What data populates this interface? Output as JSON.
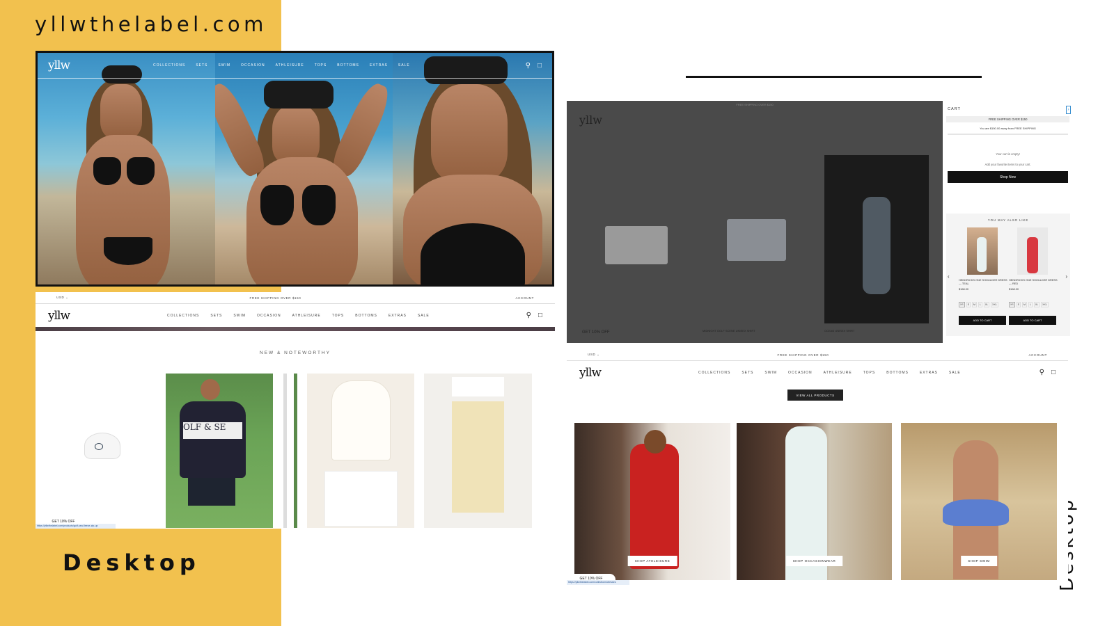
{
  "page": {
    "site_title": "yllwthelabel.com",
    "left_label": "Desktop",
    "right_label": "Desktop"
  },
  "colors": {
    "accent_yellow": "#F2C14E",
    "text": "#111111"
  },
  "brand": {
    "logo": "yllw"
  },
  "nav": {
    "items": [
      "COLLECTIONS",
      "SETS",
      "SWIM",
      "OCCASION",
      "ATHLEISURE",
      "TOPS",
      "BOTTOMS",
      "EXTRAS",
      "SALE"
    ],
    "icons": [
      "search-icon",
      "bag-icon"
    ]
  },
  "topbar": {
    "currency": "USD ⌄",
    "shipping": "FREE SHIPPING OVER $150",
    "account": "ACCOUNT"
  },
  "home": {
    "section_title": "NEW & NOTEWORTHY",
    "popup": "GET 10% OFF",
    "url": "https://yllwthelabel.com/products/golf-sea-fleece-zip-up"
  },
  "cart": {
    "title": "CART",
    "free_shipping": "FREE SHIPPING OVER $150",
    "away_text": "You are $150.00 away from FREE SHIPPING",
    "empty": "Your cart is empty!",
    "add_favorites": "Add your favorite items to your cart.",
    "shop_now": "Shop Now",
    "you_may_also_like": "YOU MAY ALSO LIKE",
    "products": [
      {
        "name": "HENDRICKS ONE SHOULDER DRESS — TEAL",
        "price": "$168.00",
        "button": "ADD TO CART"
      },
      {
        "name": "HENDRICKS ONE SHOULDER DRESS — RED",
        "price": "$168.00",
        "button": "ADD TO CART"
      }
    ],
    "sizes": [
      "XS",
      "S",
      "M",
      "L",
      "XL",
      "XXL"
    ],
    "behind": {
      "popup": "GET 10% OFF",
      "product1": "MIDNIGHT GOLF SCENE UNISEX SHIRT",
      "product2": "OCEAN UNISEX SHIRT"
    }
  },
  "collections": {
    "view_all": "VIEW ALL PRODUCTS",
    "categories": [
      "SHOP ATHLEISURE",
      "SHOP OCCASIONWEAR",
      "SHOP SWIM"
    ],
    "popup": "GET 10% OFF",
    "url": "https://yllwthelabel.com/collections/dresses"
  }
}
